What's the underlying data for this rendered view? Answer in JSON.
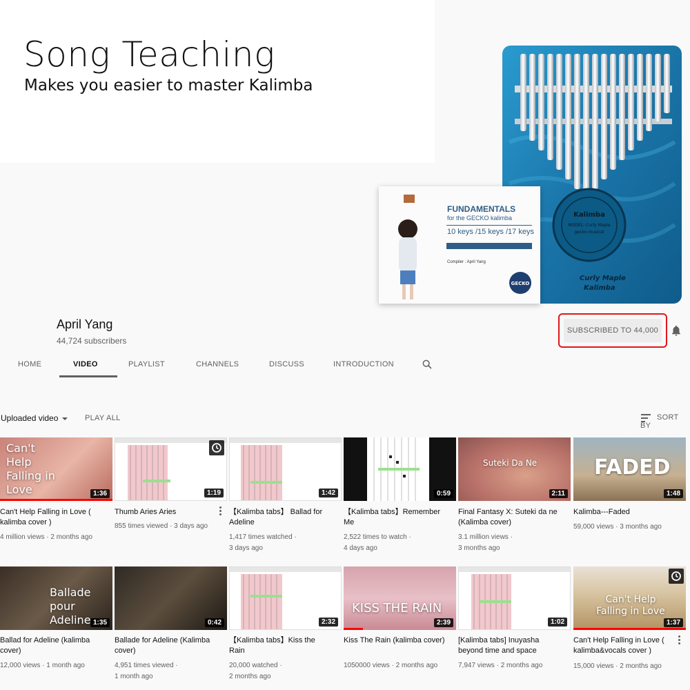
{
  "banner": {
    "headline": "Song Teaching",
    "subline": "Makes you easier to master Kalimba",
    "product_logo_text": "Curly Maple Kalimba",
    "book": {
      "title": "FUNDAMENTALS",
      "subtitle": "for the GECKO kalimba",
      "keys": "10 keys /15 keys /17 keys",
      "compiler": "Compiler : April Yang"
    }
  },
  "channel": {
    "name": "April Yang",
    "subscribers": "44,724 subscribers",
    "subscribe_label": "SUBSCRIBED TO  44,000"
  },
  "tabs": [
    "HOME",
    "VIDEO",
    "PLAYLIST",
    "CHANNELS",
    "DISCUSS",
    "INTRODUCTION"
  ],
  "filter": {
    "uploaded": "Uploaded video",
    "play_all": "PLAY ALL",
    "sort_by": "SORT BY"
  },
  "videos": [
    {
      "title": "Can't Help Falling in Love ( kalimba cover )",
      "meta1": "4 million views · 2 months ago",
      "meta2": "",
      "duration": "1:36",
      "overlay": "Can't Help Falling in Love"
    },
    {
      "title": "Thumb Aries Aries",
      "meta1": "855 times viewed · 3 days ago",
      "meta2": "",
      "duration": "1:19",
      "overlay": ""
    },
    {
      "title": "【Kalimba tabs】 Ballad for Adeline",
      "meta1": "1,417 times watched ·",
      "meta2": "3 days ago",
      "duration": "1:42",
      "overlay": ""
    },
    {
      "title": "【Kalimba tabs】Remember Me",
      "meta1": "2,522 times to watch ·",
      "meta2": "4 days ago",
      "duration": "0:59",
      "overlay": ""
    },
    {
      "title": "Final Fantasy X: Suteki da ne (Kalimba cover)",
      "meta1": "3.1 million views ·",
      "meta2": "3 months ago",
      "duration": "2:11",
      "overlay": "Suteki Da Ne"
    },
    {
      "title": "Kalimba---Faded",
      "meta1": "59,000 views · 3 months ago",
      "meta2": "",
      "duration": "1:48",
      "overlay": "FADED"
    },
    {
      "title": "Ballad for Adeline (kalimba cover)",
      "meta1": "12,000 views · 1 month ago",
      "meta2": "",
      "duration": "1:35",
      "overlay": "Ballade pour Adeline"
    },
    {
      "title": "Ballade for Adeline (Kalimba cover)",
      "meta1": "4,951 times viewed ·",
      "meta2": "1 month ago",
      "duration": "0:42",
      "overlay": ""
    },
    {
      "title": "【Kalimba tabs】Kiss the Rain",
      "meta1": "20,000 watched ·",
      "meta2": "2 months ago",
      "duration": "2:32",
      "overlay": ""
    },
    {
      "title": "Kiss The Rain (kalimba cover)",
      "meta1": "1050000 views · 2 months ago",
      "meta2": "",
      "duration": "2:39",
      "overlay": "KISS THE RAIN"
    },
    {
      "title": "[Kalimba tabs] Inuyasha beyond time and space",
      "meta1": "7,947 views · 2 months ago",
      "meta2": "",
      "duration": "1:02",
      "overlay": ""
    },
    {
      "title": "Can't Help Falling in Love ( kalimba&vocals cover )",
      "meta1": "15,000 views · 2 months ago",
      "meta2": "",
      "duration": "1:37",
      "overlay": "Can't Help Falling in Love"
    }
  ],
  "colors": {
    "highlight": "#e0161b",
    "progress": "#ff0000",
    "kalimba_blue": "#1f7fb0"
  }
}
